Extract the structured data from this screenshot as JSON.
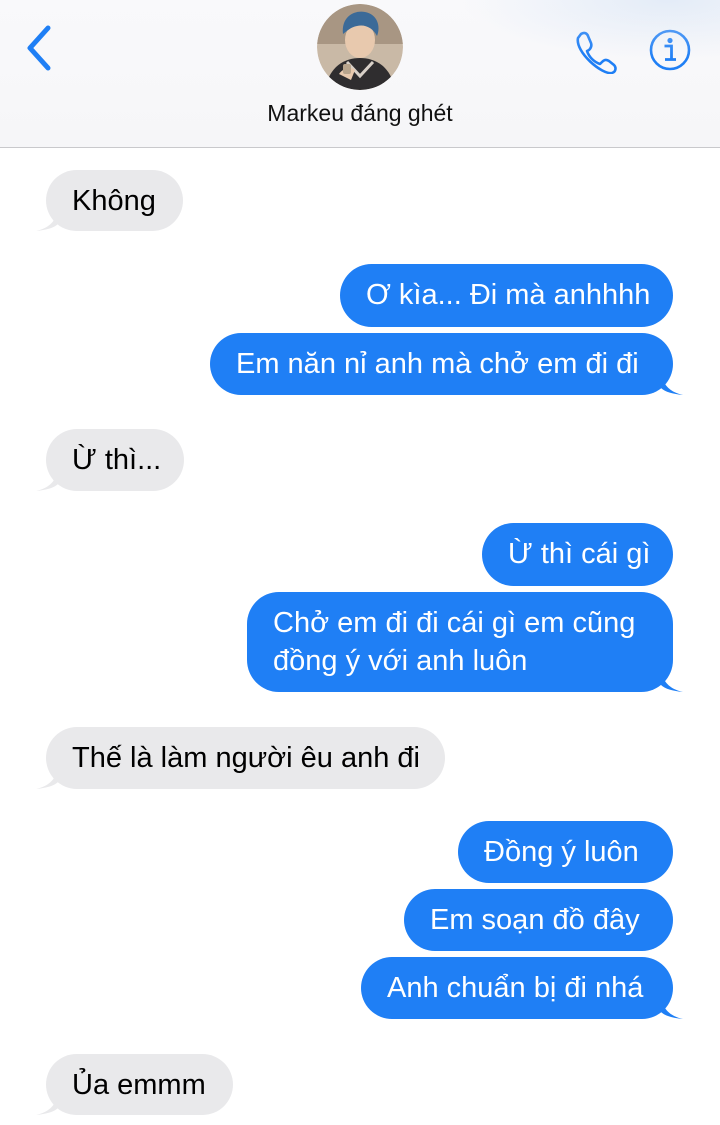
{
  "header": {
    "contact_name": "Markeu đáng ghét",
    "back_icon": "chevron-left-icon",
    "call_icon": "phone-icon",
    "info_icon": "info-icon",
    "accent_color": "#1f7ff5"
  },
  "messages": [
    {
      "direction": "incoming",
      "text": "Không"
    },
    {
      "direction": "outgoing",
      "text": "Ơ kìa... Đi mà anhhhh"
    },
    {
      "direction": "outgoing",
      "text": "Em năn nỉ anh mà chở em đi đi"
    },
    {
      "direction": "incoming",
      "text": "Ừ thì..."
    },
    {
      "direction": "outgoing",
      "text": "Ừ thì cái gì"
    },
    {
      "direction": "outgoing",
      "text_lines": [
        "Chở em đi đi cái gì em cũng",
        "đồng ý với anh luôn"
      ]
    },
    {
      "direction": "incoming",
      "text": "Thế là làm người êu anh đi"
    },
    {
      "direction": "outgoing",
      "text": "Đồng ý luôn"
    },
    {
      "direction": "outgoing",
      "text": "Em soạn đồ đây"
    },
    {
      "direction": "outgoing",
      "text": "Anh chuẩn bị đi nhá"
    },
    {
      "direction": "incoming",
      "text": "Ủa emmm"
    }
  ],
  "colors": {
    "incoming_bubble": "#e9e9eb",
    "outgoing_bubble": "#1f7ff5",
    "outgoing_text": "#ffffff",
    "incoming_text": "#000000"
  }
}
